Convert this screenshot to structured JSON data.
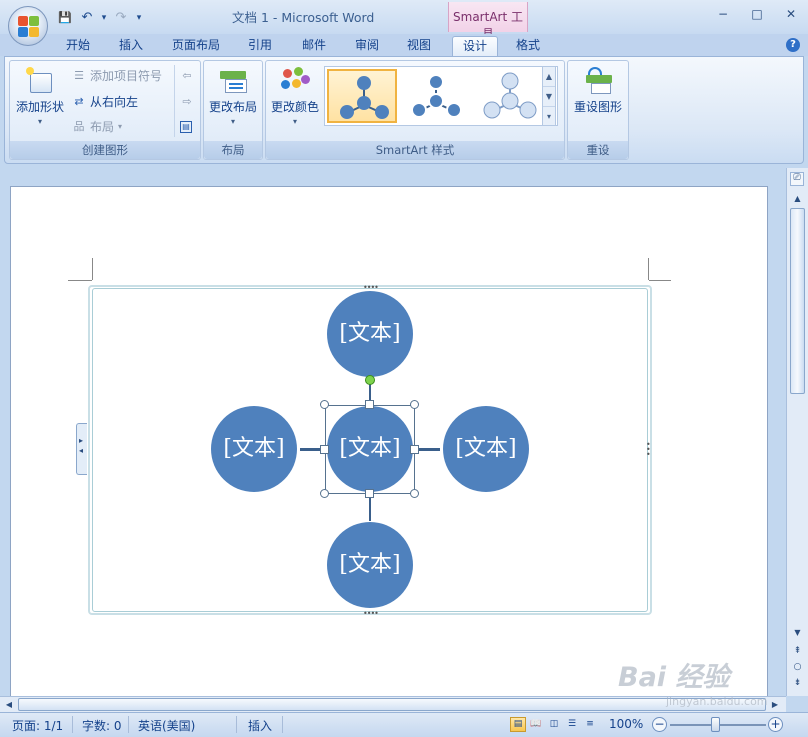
{
  "window": {
    "title": "文档 1 - Microsoft Word",
    "tool_tab_title": "SmartArt 工具",
    "controls": {
      "minimize": "−",
      "maximize": "□",
      "close": "✕"
    }
  },
  "qat": {
    "save": "💾",
    "undo": "↶",
    "undo_caret": "▾",
    "redo": "↷",
    "customize": "▾"
  },
  "tabs": [
    {
      "label": "开始"
    },
    {
      "label": "插入"
    },
    {
      "label": "页面布局"
    },
    {
      "label": "引用"
    },
    {
      "label": "邮件"
    },
    {
      "label": "审阅"
    },
    {
      "label": "视图"
    },
    {
      "label": "设计"
    },
    {
      "label": "格式"
    }
  ],
  "active_tab": "设计",
  "help": "?",
  "ribbon": {
    "create_graphic": {
      "label": "创建图形",
      "add_shape": "添加形状",
      "add_bullet": "添加项目符号",
      "right_to_left": "从右向左",
      "layout": "布局",
      "promote": "⇦",
      "demote": "⇨"
    },
    "layouts": {
      "label": "布局",
      "change_layout": "更改布局"
    },
    "styles": {
      "label": "SmartArt 样式",
      "change_colors": "更改颜色"
    },
    "reset": {
      "label": "重设",
      "reset_graphic": "重设图形"
    }
  },
  "smartart": {
    "center": "[文本]",
    "top": "[文本]",
    "left": "[文本]",
    "right": "[文本]",
    "bottom": "[文本]",
    "fill_color": "#4f81bd",
    "connector_color": "#3a5f8b",
    "text_pane_arrows": "▸ ◂"
  },
  "statusbar": {
    "page": "页面: 1/1",
    "words": "字数: 0",
    "language": "英语(美国)",
    "mode": "插入",
    "zoom": "100%",
    "zoom_minus": "−",
    "zoom_plus": "+"
  },
  "scroll": {
    "up": "▲",
    "down": "▼",
    "left": "◀",
    "right": "▶",
    "prev": "⯭",
    "select": "○",
    "next": "⯯"
  },
  "watermark": {
    "brand": "Bai 经验",
    "url": "jingyan.baidu.com"
  },
  "colors": {
    "accent": "#4f81bd",
    "ribbon_text": "#15428b",
    "tool_tab": "#f2d2e8"
  }
}
